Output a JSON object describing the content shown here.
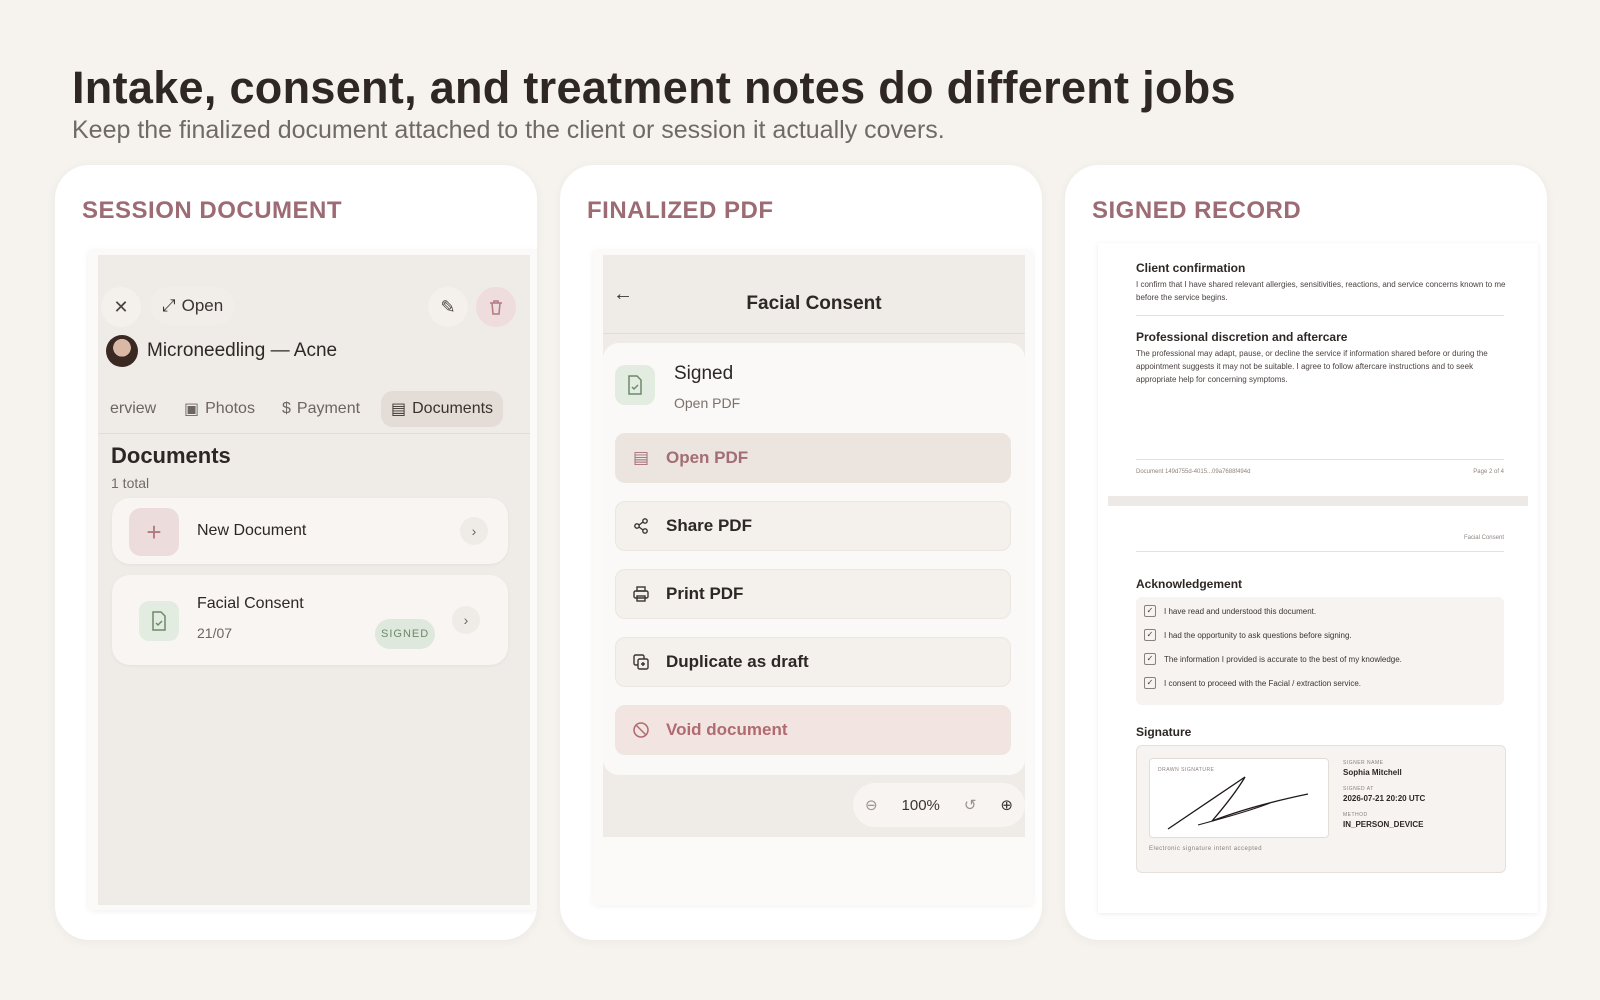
{
  "hero": {
    "title": "Intake, consent, and treatment notes do different jobs",
    "subtitle": "Keep the finalized document attached to the client or session it actually covers."
  },
  "panels": [
    {
      "label": "SESSION DOCUMENT"
    },
    {
      "label": "FINALIZED PDF"
    },
    {
      "label": "SIGNED RECORD"
    }
  ],
  "session": {
    "open_label": "Open",
    "title": "Microneedling — Acne",
    "tabs": [
      "erview",
      "Photos",
      "Payment",
      "Documents"
    ],
    "active_tab": "Documents",
    "docs_heading": "Documents",
    "docs_count": "1 total",
    "new_doc_label": "New Document",
    "doc_title": "Facial Consent",
    "doc_date": "21/07",
    "doc_badge": "SIGNED"
  },
  "pdf": {
    "title": "Facial Consent",
    "status_title": "Signed",
    "status_sub": "Open PDF",
    "actions": [
      "Open PDF",
      "Share PDF",
      "Print PDF",
      "Duplicate as draft",
      "Void document"
    ],
    "zoom": "100%"
  },
  "record": {
    "client_heading": "Client confirmation",
    "client_text": "I confirm that I have shared relevant allergies, sensitivities, reactions, and service concerns known to me before the service begins.",
    "prof_heading": "Professional discretion and aftercare",
    "prof_text": "The professional may adapt, pause, or decline the service if information shared before or during the appointment suggests it may not be suitable. I agree to follow aftercare instructions and to seek appropriate help for concerning symptoms.",
    "footer_doc": "Document 149d755d-4015...09a7688f494d",
    "footer_page": "Page 2 of 4",
    "page_header": "Facial Consent",
    "ack_heading": "Acknowledgement",
    "ack_items": [
      "I have read and understood this document.",
      "I had the opportunity to ask questions before signing.",
      "The information I provided is accurate to the best of my knowledge.",
      "I consent to proceed with the Facial / extraction service."
    ],
    "sig_heading": "Signature",
    "drawn_label": "DRAWN SIGNATURE",
    "signer_name_label": "SIGNER NAME",
    "signer_name": "Sophia Mitchell",
    "signed_at_label": "SIGNED AT",
    "signed_at": "2026-07-21 20:20 UTC",
    "method_label": "METHOD",
    "method": "IN_PERSON_DEVICE",
    "intent_note": "Electronic signature intent accepted"
  },
  "colors": {
    "background": "#f6f3ef",
    "accent": "#9c6b73",
    "signed_green": "#6d8a6a",
    "danger": "#b06b70"
  }
}
